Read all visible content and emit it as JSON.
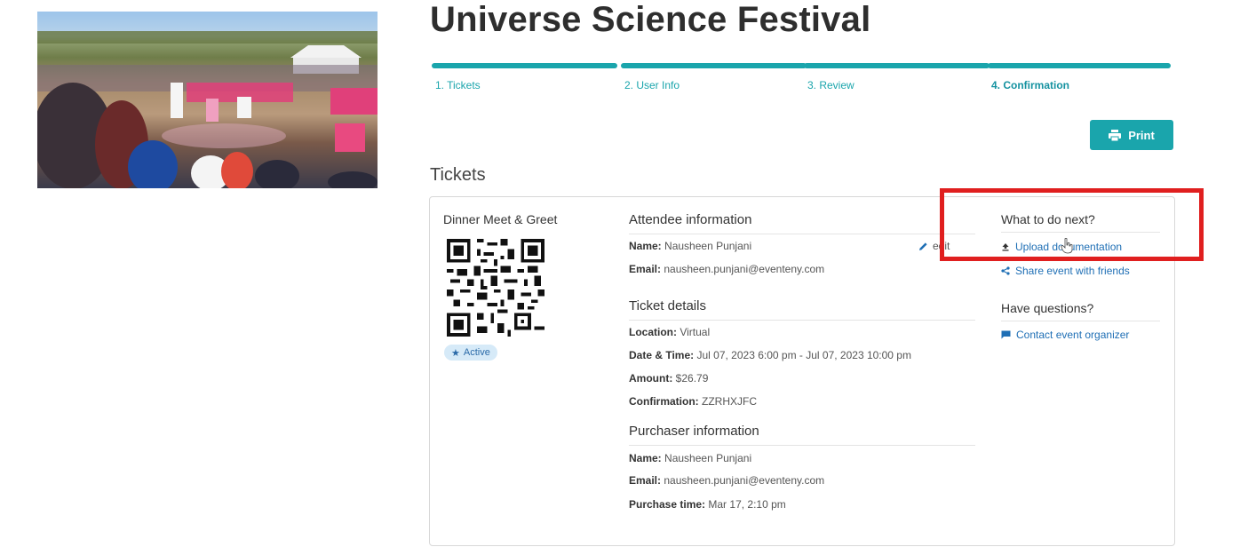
{
  "event": {
    "title": "Universe Science Festival",
    "photo_icon": "crowd-photo"
  },
  "stepper": {
    "steps": [
      {
        "label": "1. Tickets",
        "state": "done"
      },
      {
        "label": "2. User Info",
        "state": "done"
      },
      {
        "label": "3. Review",
        "state": "done"
      },
      {
        "label": "4. Confirmation",
        "state": "current"
      }
    ]
  },
  "toolbar": {
    "print_label": "Print",
    "print_icon": "printer-icon"
  },
  "tickets_heading": "Tickets",
  "ticket": {
    "name": "Dinner Meet & Greet",
    "status": "Active",
    "attendee": {
      "heading": "Attendee information",
      "edit_label": "edit",
      "name_label": "Name:",
      "name_value": "Nausheen Punjani",
      "email_label": "Email:",
      "email_value": "nausheen.punjani@eventeny.com"
    },
    "details": {
      "heading": "Ticket details",
      "location_label": "Location:",
      "location_value": "Virtual",
      "datetime_label": "Date & Time:",
      "datetime_value": "Jul 07, 2023 6:00 pm - Jul 07, 2023 10:00 pm",
      "amount_label": "Amount:",
      "amount_value": "$26.79",
      "confirmation_label": "Confirmation:",
      "confirmation_value": "ZZRHXJFC"
    },
    "purchaser": {
      "heading": "Purchaser information",
      "name_label": "Name:",
      "name_value": "Nausheen Punjani",
      "email_label": "Email:",
      "email_value": "nausheen.punjani@eventeny.com",
      "time_label": "Purchase time:",
      "time_value": "Mar 17, 2:10 pm"
    }
  },
  "next_steps": {
    "heading": "What to do next?",
    "upload_label": "Upload documentation",
    "share_label": "Share event with friends"
  },
  "questions": {
    "heading": "Have questions?",
    "contact_label": "Contact event organizer"
  },
  "colors": {
    "accent": "#1aa5ac",
    "link": "#1f6fb5",
    "highlight": "#e01f1f",
    "badge_bg": "#d6eaf8"
  }
}
